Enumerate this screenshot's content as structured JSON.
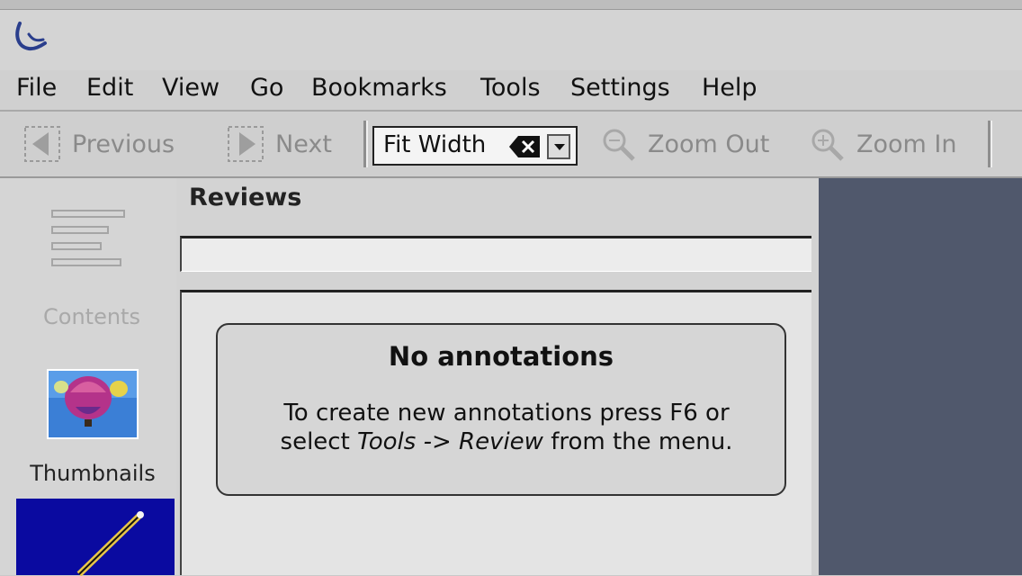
{
  "menu": {
    "items": [
      {
        "label": "File"
      },
      {
        "label": "Edit"
      },
      {
        "label": "View"
      },
      {
        "label": "Go"
      },
      {
        "label": "Bookmarks"
      },
      {
        "label": "Tools"
      },
      {
        "label": "Settings"
      },
      {
        "label": "Help"
      }
    ]
  },
  "toolbar": {
    "previous_label": "Previous",
    "next_label": "Next",
    "zoom_value": "Fit Width",
    "zoom_out_label": "Zoom Out",
    "zoom_in_label": "Zoom In"
  },
  "sidebar": {
    "contents_label": "Contents",
    "thumbnails_label": "Thumbnails"
  },
  "panel": {
    "title": "Reviews",
    "empty_title": "No annotations",
    "empty_line1": "To create new annotations press F6 or",
    "empty_line2_pre": "select ",
    "empty_line2_tools": "Tools -> Review",
    "empty_line2_post": " from the menu."
  },
  "colors": {
    "review_tab_bg": "#0a0aa0",
    "right_area_bg": "#50586c"
  }
}
